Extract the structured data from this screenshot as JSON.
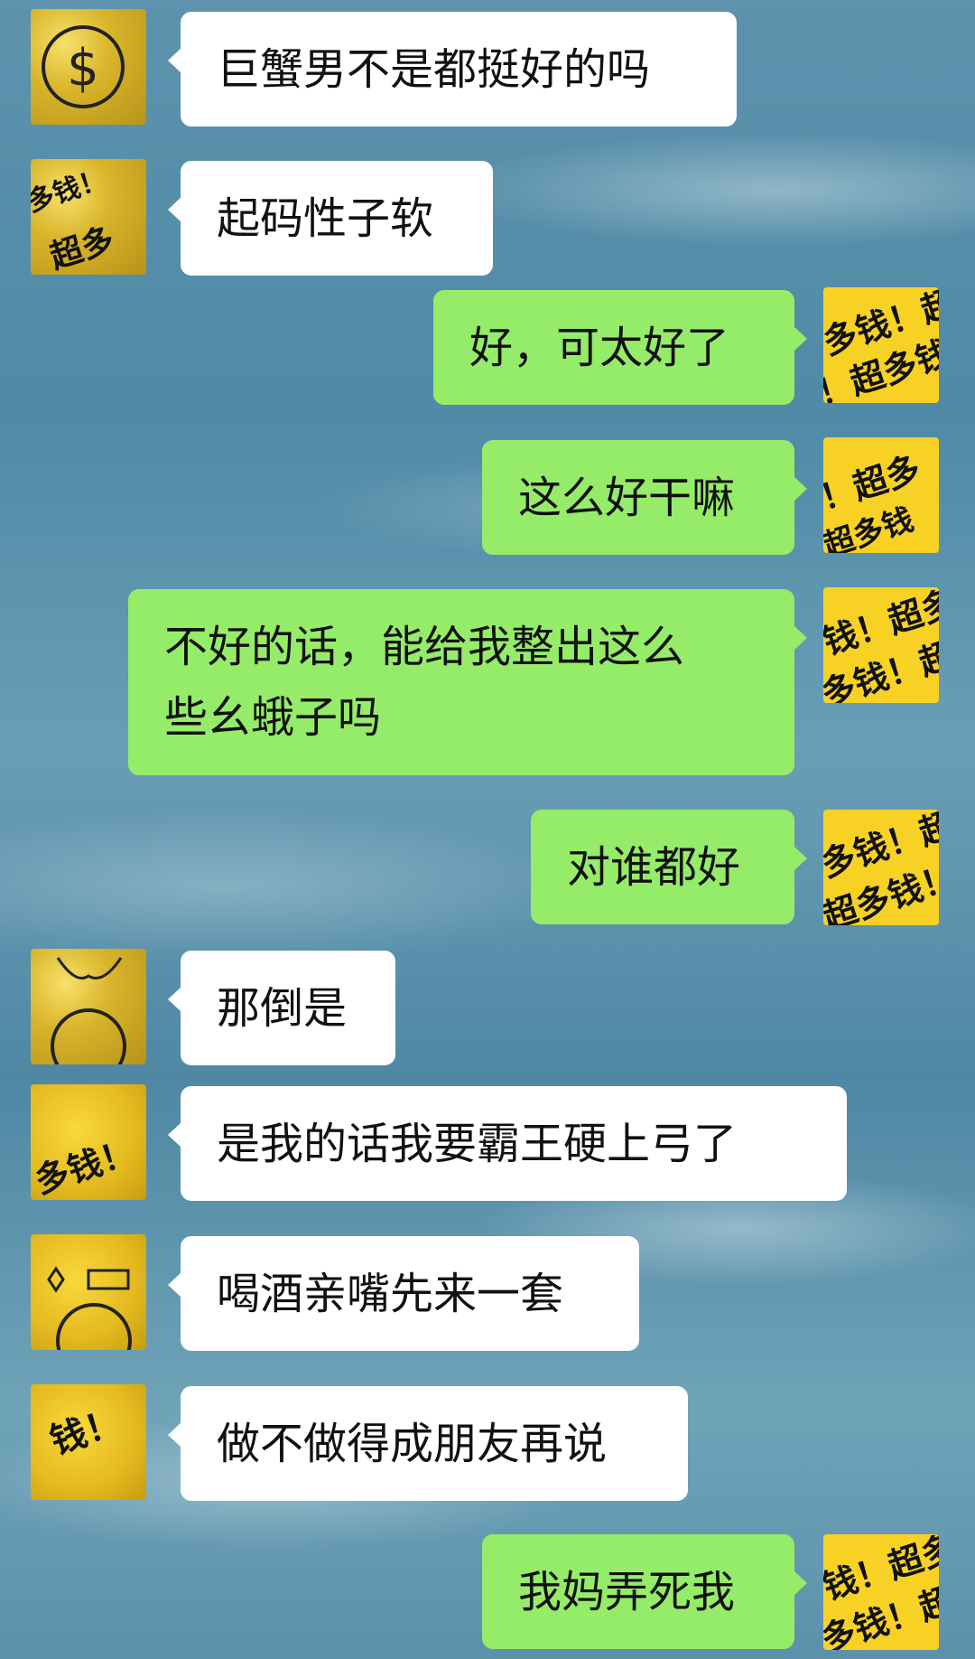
{
  "messages": [
    {
      "side": "left",
      "avatar": "coin-avatar",
      "text": "巨蟹男不是都挺好的吗"
    },
    {
      "side": "left",
      "avatar": "money-text-avatar",
      "text": "起码性子软"
    },
    {
      "side": "right",
      "avatar": "money-text-avatar",
      "text": "好，可太好了"
    },
    {
      "side": "right",
      "avatar": "money-text-avatar",
      "text": "这么好干嘛"
    },
    {
      "side": "right",
      "avatar": "money-text-avatar",
      "text": "不好的话，能给我整出这么\n些幺蛾子吗"
    },
    {
      "side": "right",
      "avatar": "money-text-avatar",
      "text": "对谁都好"
    },
    {
      "side": "left",
      "avatar": "coin-avatar",
      "text": "那倒是"
    },
    {
      "side": "left",
      "avatar": "money-text-avatar",
      "text": "是我的话我要霸王硬上弓了"
    },
    {
      "side": "left",
      "avatar": "coin-avatar",
      "text": "喝酒亲嘴先来一套"
    },
    {
      "side": "left",
      "avatar": "money-text-avatar",
      "text": "做不做得成朋友再说"
    },
    {
      "side": "right",
      "avatar": "money-text-avatar",
      "text": "我妈弄死我"
    }
  ],
  "avatar_text": "多钱！超多钱！",
  "colors": {
    "left_bubble": "#ffffff",
    "right_bubble": "#95ec69",
    "avatar_yellow": "#f7d225"
  }
}
